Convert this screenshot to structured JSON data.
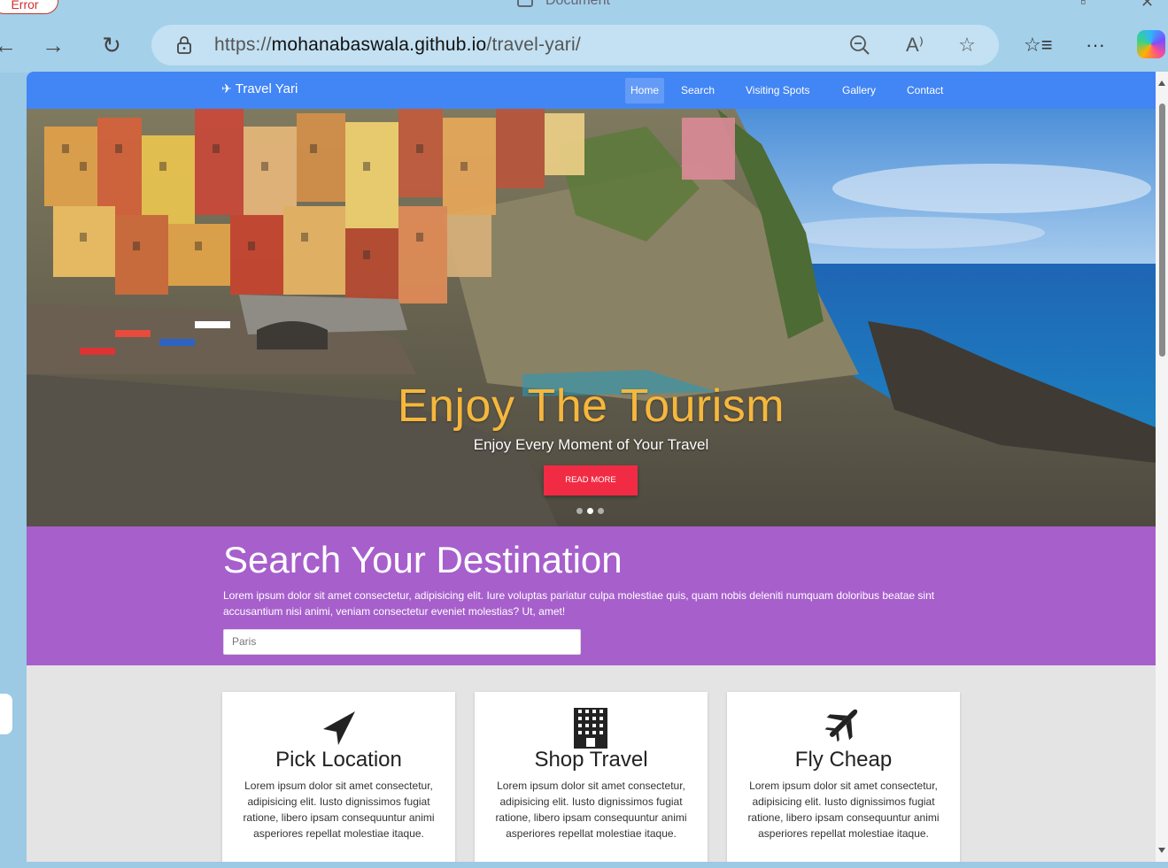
{
  "browser": {
    "error_badge": "Error",
    "tab_title": "Document",
    "url_prefix": "https://",
    "url_host": "mohanabaswala.github.io",
    "url_path": "/travel-yari/"
  },
  "site": {
    "brand": "Travel Yari",
    "nav": [
      {
        "label": "Home",
        "active": true
      },
      {
        "label": "Search"
      },
      {
        "label": "Visiting Spots"
      },
      {
        "label": "Gallery"
      },
      {
        "label": "Contact"
      }
    ],
    "hero": {
      "title": "Enjoy The Tourism",
      "subtitle": "Enjoy Every Moment of Your Travel",
      "button": "READ MORE",
      "accent": "#f6b73c",
      "button_color": "#f22b44"
    },
    "search": {
      "heading": "Search Your Destination",
      "text": "Lorem ipsum dolor sit amet consectetur, adipisicing elit. Iure voluptas pariatur culpa molestiae quis, quam nobis deleniti numquam doloribus beatae sint accusantium nisi animi, veniam consectetur eveniet molestias? Ut, amet!",
      "value": "Paris",
      "bg": "#a75fcc"
    },
    "cards": [
      {
        "icon": "location-arrow-icon",
        "title": "Pick Location",
        "text": "Lorem ipsum dolor sit amet consectetur, adipisicing elit. Iusto dignissimos fugiat ratione, libero ipsam consequuntur animi asperiores repellat molestiae itaque."
      },
      {
        "icon": "building-icon",
        "title": "Shop Travel",
        "text": "Lorem ipsum dolor sit amet consectetur, adipisicing elit. Iusto dignissimos fugiat ratione, libero ipsam consequuntur animi asperiores repellat molestiae itaque."
      },
      {
        "icon": "plane-icon",
        "title": "Fly Cheap",
        "text": "Lorem ipsum dolor sit amet consectetur, adipisicing elit. Iusto dignissimos fugiat ratione, libero ipsam consequuntur animi asperiores repellat molestiae itaque."
      }
    ]
  }
}
